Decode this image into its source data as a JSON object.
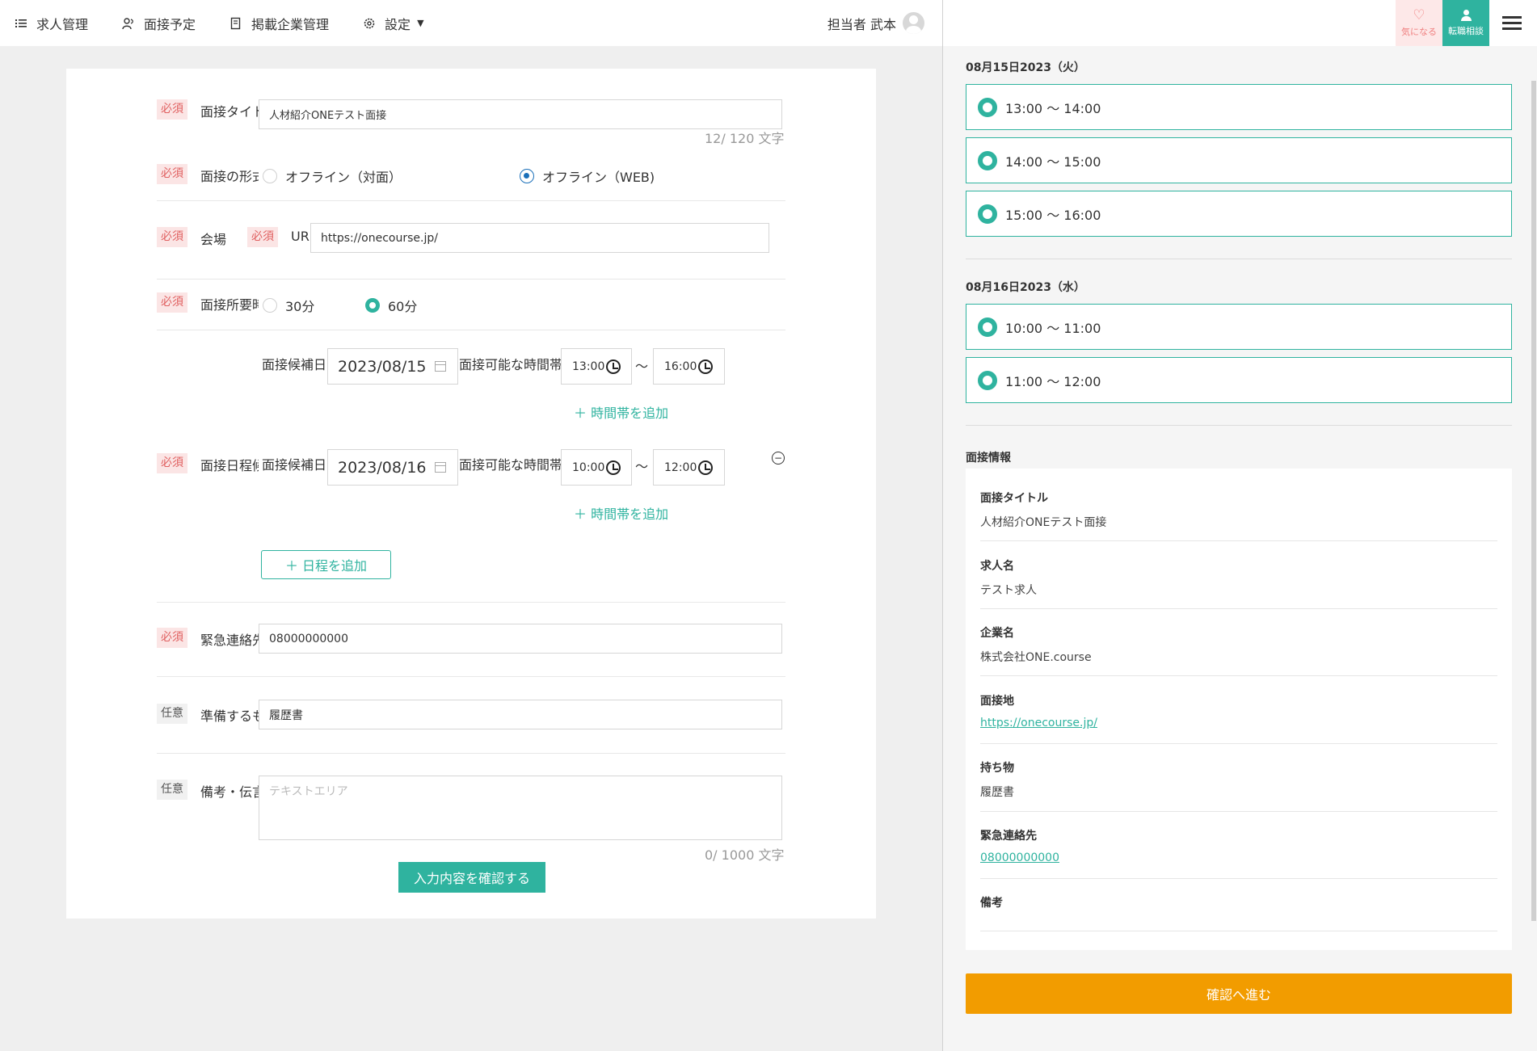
{
  "nav": {
    "items": [
      {
        "label": "求人管理",
        "icon": "list-icon"
      },
      {
        "label": "面接予定",
        "icon": "people-icon"
      },
      {
        "label": "掲載企業管理",
        "icon": "document-icon"
      },
      {
        "label": "設定",
        "icon": "gear-icon"
      }
    ],
    "user": "担当者 武本"
  },
  "form": {
    "required_badge": "必須",
    "optional_badge": "任意",
    "title_label": "面接タイトル",
    "title_value": "人材紹介ONEテスト面接",
    "title_counter": "12/ 120 文字",
    "format_label": "面接の形式",
    "format_options": [
      "オフライン（対面）",
      "オフライン（WEB)"
    ],
    "venue_label": "会場",
    "url_label": "URL",
    "url_value": "https://onecourse.jp/",
    "duration_label": "面接所要時間",
    "duration_options": [
      "30分",
      "60分"
    ],
    "candidate_date_label": "面接候補日",
    "available_time_label": "面接可能な時間帯",
    "schedule_label": "面接日程候補",
    "tilde": "〜",
    "dates": [
      {
        "date": "2023/08/15",
        "from": "13:00",
        "to": "16:00"
      },
      {
        "date": "2023/08/16",
        "from": "10:00",
        "to": "12:00"
      }
    ],
    "add_time_slot": "＋ 時間帯を追加",
    "add_date": "＋ 日程を追加",
    "emergency_label": "緊急連絡先",
    "emergency_value": "08000000000",
    "prepare_label": "準備するもの",
    "prepare_value": "履歴書",
    "notes_label": "備考・伝言",
    "notes_placeholder": "テキストエリア",
    "notes_counter": "0/ 1000 文字",
    "submit_label": "入力内容を確認する"
  },
  "right": {
    "fav_label": "気になる",
    "consult_label": "転職相談",
    "date1": "08月15日2023（火）",
    "slots1": [
      "13:00 〜 14:00",
      "14:00 〜 15:00",
      "15:00 〜 16:00"
    ],
    "date2": "08月16日2023（水）",
    "slots2": [
      "10:00 〜 11:00",
      "11:00 〜 12:00"
    ],
    "info_heading": "面接情報",
    "info": [
      {
        "key": "面接タイトル",
        "value": "人材紹介ONEテスト面接"
      },
      {
        "key": "求人名",
        "value": "テスト求人"
      },
      {
        "key": "企業名",
        "value": "株式会社ONE.course"
      },
      {
        "key": "面接地",
        "value": "https://onecourse.jp/"
      },
      {
        "key": "持ち物",
        "value": "履歴書"
      },
      {
        "key": "緊急連絡先",
        "value": "08000000000"
      },
      {
        "key": "備考",
        "value": ""
      }
    ],
    "confirm_label": "確認へ進む"
  }
}
